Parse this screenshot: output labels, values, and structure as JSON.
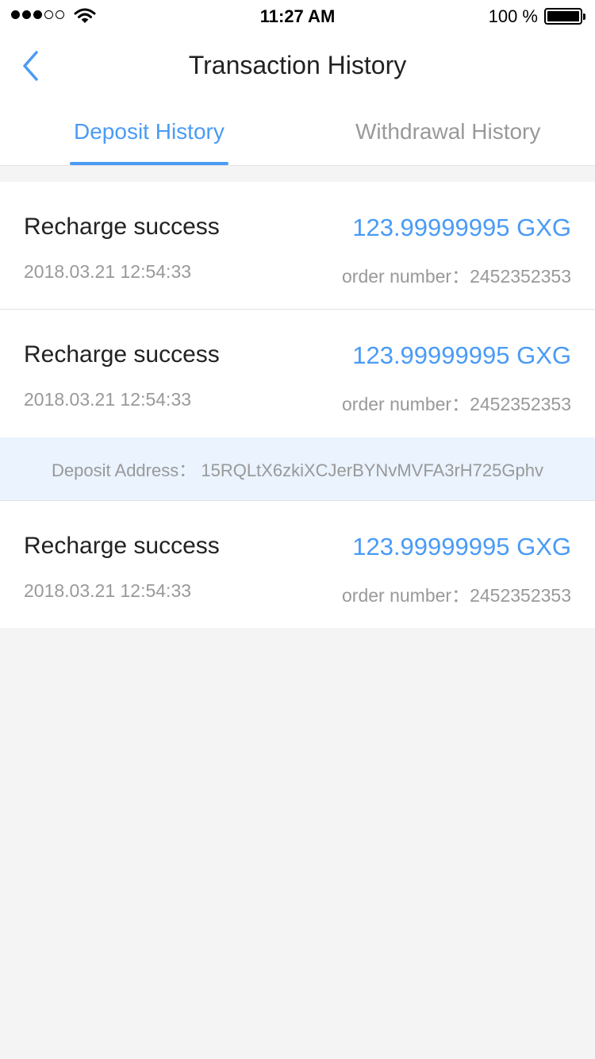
{
  "status_bar": {
    "time": "11:27 AM",
    "battery": "100 %",
    "signal_icon": "signal-dots-icon",
    "wifi_icon": "wifi-icon",
    "battery_icon": "battery-icon"
  },
  "nav": {
    "title": "Transaction History",
    "back_icon": "chevron-left-icon"
  },
  "tabs": [
    {
      "label": "Deposit History",
      "active": true
    },
    {
      "label": "Withdrawal History",
      "active": false
    }
  ],
  "records": [
    {
      "status": "Recharge success",
      "amount": "123.99999995 GXG",
      "date": "2018.03.21 12:54:33",
      "order": "order number：2452352353"
    },
    {
      "status": "Recharge success",
      "amount": "123.99999995 GXG",
      "date": "2018.03.21 12:54:33",
      "order": "order number：2452352353"
    },
    {
      "status": "Recharge success",
      "amount": "123.99999995 GXG",
      "date": "2018.03.21 12:54:33",
      "order": "order number：2452352353"
    }
  ],
  "deposit_address": "Deposit Address：  15RQLtX6zkiXCJerBYNvMVFA3rH725Gphv",
  "colors": {
    "accent": "#4a9bf5",
    "background": "#f4f4f4",
    "address_bg": "#eaf3fe",
    "muted_text": "#999999"
  }
}
